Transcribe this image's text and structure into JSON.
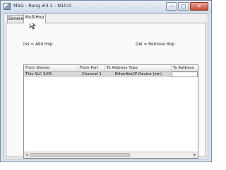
{
  "window": {
    "title": "MSG - Rung #3:1 - N10:0",
    "buttons": {
      "minimize": "–",
      "maximize": "□",
      "close": "✕"
    }
  },
  "tabs": [
    {
      "label": "General",
      "active": false
    },
    {
      "label": "MultiHop",
      "active": true
    }
  ],
  "actions": {
    "add_hop": "Ins = Add Hop",
    "remove_hop": "Del = Remove Hop"
  },
  "table": {
    "columns": [
      "From Device",
      "From Port",
      "To Address Type",
      "To Address"
    ],
    "rows": [
      [
        "This SLC 5/05",
        "Channel 1",
        "EtherNet/IP Device (str.)",
        ""
      ]
    ]
  },
  "scrollbar": {
    "left_arrow": "◂",
    "right_arrow": "▸"
  },
  "icons": [
    "app-icon",
    "minimize-icon",
    "maximize-icon",
    "close-icon",
    "mouse-cursor-icon",
    "scroll-left-icon",
    "scroll-right-icon"
  ]
}
